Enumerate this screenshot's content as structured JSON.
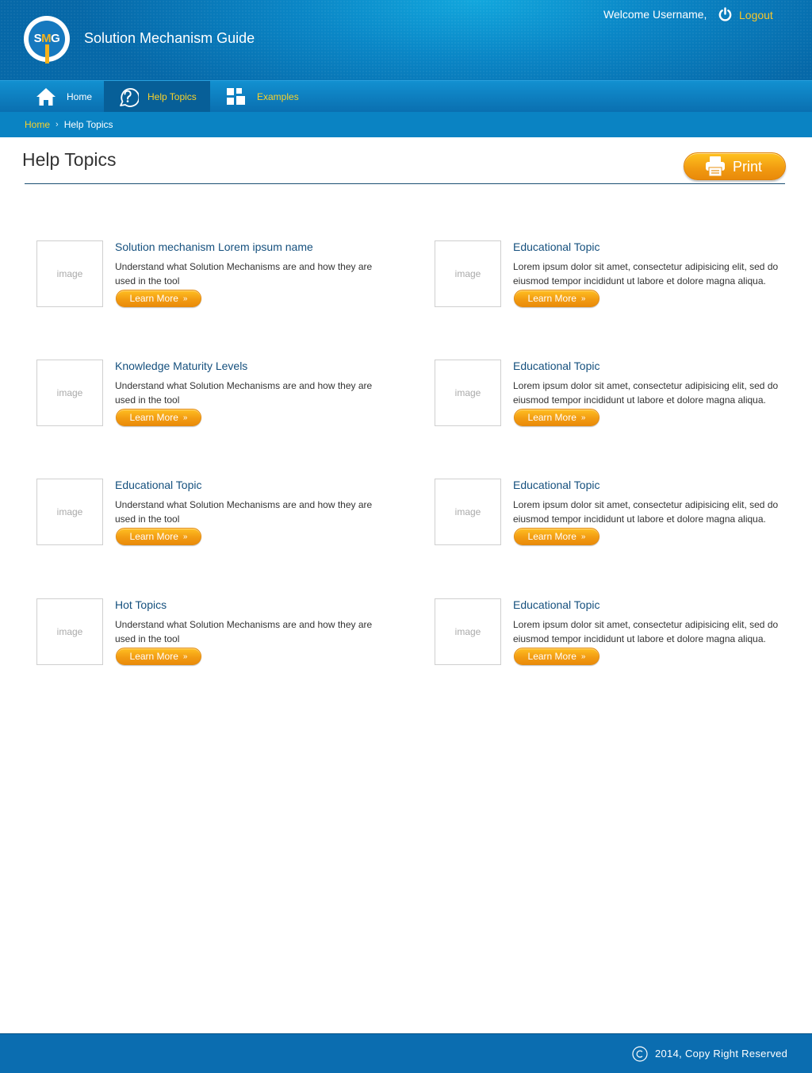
{
  "header": {
    "logo_text": "SMG",
    "app_title": "Solution Mechanism Guide",
    "welcome": "Welcome Username,",
    "logout": "Logout"
  },
  "nav": {
    "items": [
      {
        "label": "Home",
        "icon": "home-icon"
      },
      {
        "label": "Help Topics",
        "icon": "help-icon"
      },
      {
        "label": "Examples",
        "icon": "grid-icon"
      }
    ]
  },
  "breadcrumb": {
    "home": "Home",
    "current": "Help Topics"
  },
  "page": {
    "title": "Help Topics",
    "print_label": "Print"
  },
  "topics": [
    {
      "title": "Solution mechanism Lorem ipsum name",
      "desc": "Understand what Solution Mechanisms are and how they are used in the tool",
      "image": "image",
      "button": "Learn More"
    },
    {
      "title": "Educational Topic",
      "desc": "Lorem ipsum dolor sit amet, consectetur adipisicing elit, sed do eiusmod tempor incididunt ut labore et dolore magna aliqua.",
      "image": "image",
      "button": "Learn More"
    },
    {
      "title": "Knowledge Maturity Levels",
      "desc": "Understand what Solution Mechanisms are and how they are used in the tool",
      "image": "image",
      "button": "Learn More"
    },
    {
      "title": "Educational Topic",
      "desc": "Lorem ipsum dolor sit amet, consectetur adipisicing elit, sed do eiusmod tempor incididunt ut labore et dolore magna aliqua.",
      "image": "image",
      "button": "Learn More"
    },
    {
      "title": "Educational Topic",
      "desc": "Understand what Solution Mechanisms are and how they are used in the tool",
      "image": "image",
      "button": "Learn More"
    },
    {
      "title": "Educational Topic",
      "desc": "Lorem ipsum dolor sit amet, consectetur adipisicing elit, sed do eiusmod tempor incididunt ut labore et dolore magna aliqua.",
      "image": "image",
      "button": "Learn More"
    },
    {
      "title": "Hot Topics",
      "desc": "Understand what Solution Mechanisms are and how they are used in the tool",
      "image": "image",
      "button": "Learn More"
    },
    {
      "title": "Educational Topic",
      "desc": "Lorem ipsum dolor sit amet, consectetur adipisicing elit, sed do eiusmod tempor incididunt ut labore et dolore magna aliqua.",
      "image": "image",
      "button": "Learn More"
    }
  ],
  "footer": {
    "copyright": "2014, Copy Right Reserved"
  },
  "colors": {
    "header_blue": "#0a86c6",
    "nav_blue": "#0a6fb0",
    "accent_yellow": "#f8d12a",
    "button_orange": "#f29c12",
    "title_blue": "#15507e"
  }
}
